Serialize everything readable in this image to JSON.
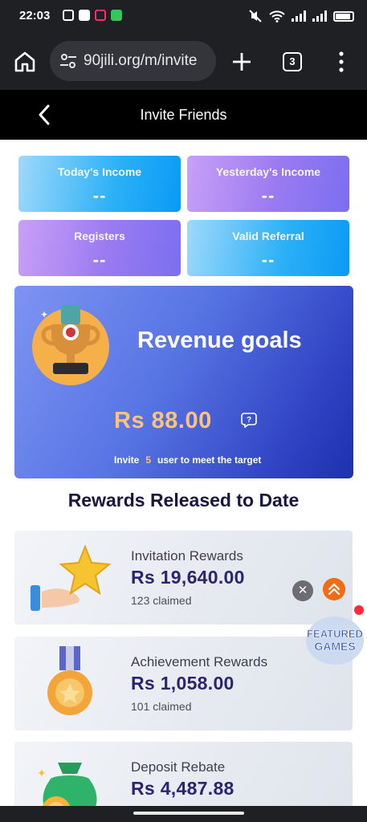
{
  "status_bar": {
    "time": "22:03",
    "left_icons": [
      "instagram-icon",
      "facebook-icon",
      "tiktok-icon",
      "messages-icon"
    ],
    "right_icons": [
      "mute-icon",
      "wifi-icon",
      "signal-icon",
      "signal-icon",
      "battery-icon"
    ]
  },
  "browser": {
    "url": "90jili.org/m/invite",
    "tab_count": "3"
  },
  "header": {
    "title": "Invite Friends"
  },
  "stats": [
    {
      "label": "Today's Income",
      "value": "--"
    },
    {
      "label": "Yesterday's Income",
      "value": "--"
    },
    {
      "label": "Registers",
      "value": "--"
    },
    {
      "label": "Valid Referral",
      "value": "--"
    }
  ],
  "goal": {
    "title": "Revenue goals",
    "amount": "Rs  88.00",
    "note_prefix": "Invite",
    "note_count": "5",
    "note_suffix": "user to meet the target"
  },
  "rewards_section": {
    "title": "Rewards Released to Date"
  },
  "rewards": [
    {
      "name": "Invitation Rewards",
      "amount": "Rs  19,640.00",
      "claimed": "123 claimed"
    },
    {
      "name": "Achievement Rewards",
      "amount": "Rs  1,058.00",
      "claimed": "101 claimed"
    },
    {
      "name": "Deposit Rebate",
      "amount": "Rs  4,487.88",
      "claimed": ""
    }
  ],
  "floating": {
    "close_label": "✕",
    "badge_text": "FEATURED GAMES"
  },
  "colors": {
    "accent_blue": "#0a9af5",
    "accent_purple": "#9a7af1",
    "goal_amount": "#ffc27a",
    "reward_amount": "#2b2470"
  }
}
